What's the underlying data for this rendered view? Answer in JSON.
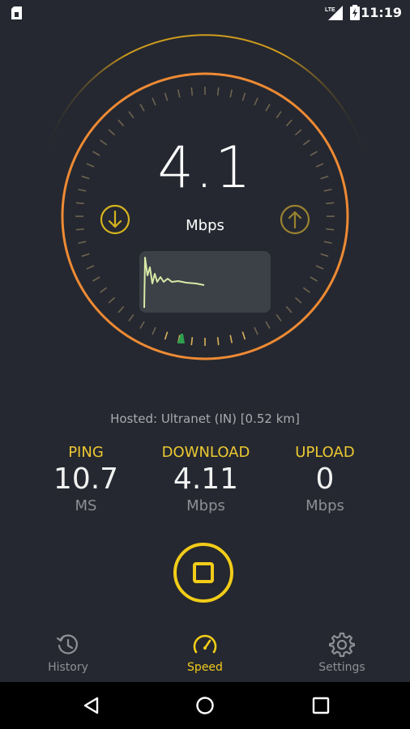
{
  "status_bar": {
    "time": "11:19",
    "icons": [
      "sim-card-icon",
      "lte-signal-icon",
      "battery-charging-icon"
    ]
  },
  "gauge": {
    "speed_value": "4.1",
    "speed_unit": "Mbps",
    "accent_orange": "#ee8a34",
    "accent_yellow": "#d6b31e",
    "icons": [
      "download-arrow-icon",
      "upload-arrow-icon"
    ]
  },
  "server": {
    "text": "Hosted: Ultranet (IN) [0.52 km]"
  },
  "metrics": {
    "ping": {
      "label": "PING",
      "value": "10.7",
      "unit": "MS"
    },
    "download": {
      "label": "DOWNLOAD",
      "value": "4.11",
      "unit": "Mbps"
    },
    "upload": {
      "label": "UPLOAD",
      "value": "0",
      "unit": "Mbps"
    }
  },
  "stop_button": {
    "icon": "stop-icon",
    "color": "#f2cc18"
  },
  "bottom_nav": {
    "history": {
      "label": "History",
      "icon": "history-icon"
    },
    "speed": {
      "label": "Speed",
      "icon": "speedometer-icon",
      "active": true
    },
    "settings": {
      "label": "Settings",
      "icon": "gear-icon"
    }
  },
  "system_nav": [
    "back-icon",
    "home-icon",
    "recents-icon"
  ]
}
